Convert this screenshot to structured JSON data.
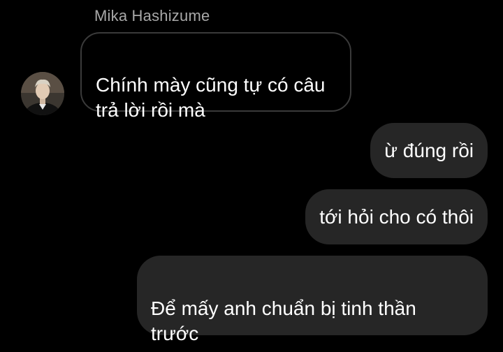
{
  "conversation": {
    "sender_name": "Mika Hashizume",
    "incoming_message": "Chính mày cũng tự có câu\ntrả lời rồi mà",
    "outgoing_messages": [
      "ừ đúng rồi",
      "tới hỏi cho có thôi",
      "Để mấy anh chuẩn bị tinh thần\ntrước"
    ]
  },
  "colors": {
    "background": "#000000",
    "incoming_border": "#3a3a3a",
    "outgoing_bubble": "#262626",
    "sender_name": "#a8a8a8",
    "text": "#ffffff"
  }
}
